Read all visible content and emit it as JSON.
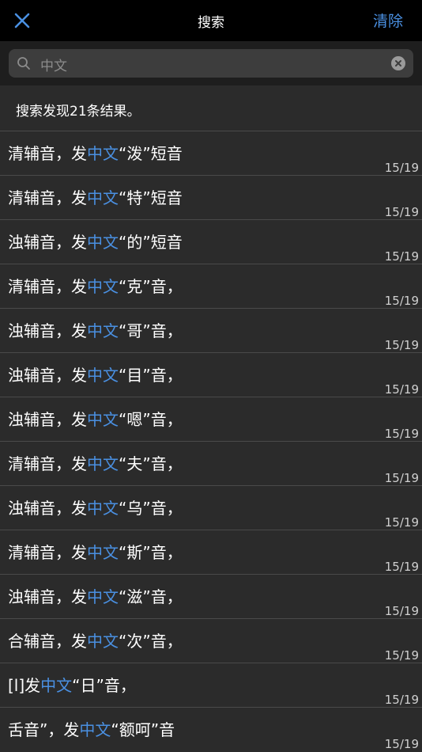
{
  "nav": {
    "title": "搜索",
    "clear_label": "清除",
    "close_icon": "close-icon"
  },
  "search": {
    "value": "中文",
    "placeholder": "中文"
  },
  "summary": "搜索发现21条结果。",
  "colors": {
    "accent": "#4a90e2",
    "background": "#2b2b2b",
    "nav_background": "#000000"
  },
  "results": [
    {
      "pre": "清辅音，发",
      "hl": "中文",
      "post": "“泼”短音",
      "page": "15/19"
    },
    {
      "pre": "清辅音，发",
      "hl": "中文",
      "post": "“特”短音",
      "page": "15/19"
    },
    {
      "pre": "浊辅音，发",
      "hl": "中文",
      "post": "“的”短音",
      "page": "15/19"
    },
    {
      "pre": "清辅音，发",
      "hl": "中文",
      "post": "“克”音，",
      "page": "15/19"
    },
    {
      "pre": "浊辅音，发",
      "hl": "中文",
      "post": "“哥”音，",
      "page": "15/19"
    },
    {
      "pre": "浊辅音，发",
      "hl": "中文",
      "post": "“目”音，",
      "page": "15/19"
    },
    {
      "pre": "浊辅音，发",
      "hl": "中文",
      "post": "“嗯”音，",
      "page": "15/19"
    },
    {
      "pre": "清辅音，发",
      "hl": "中文",
      "post": "“夫”音，",
      "page": "15/19"
    },
    {
      "pre": "浊辅音，发",
      "hl": "中文",
      "post": "“乌”音，",
      "page": "15/19"
    },
    {
      "pre": "清辅音，发",
      "hl": "中文",
      "post": "“斯”音，",
      "page": "15/19"
    },
    {
      "pre": "浊辅音，发",
      "hl": "中文",
      "post": "“滋”音，",
      "page": "15/19"
    },
    {
      "pre": "合辅音，发",
      "hl": "中文",
      "post": "“次”音，",
      "page": "15/19"
    },
    {
      "pre": " [l]发",
      "hl": "中文",
      "post": "“日”音，",
      "page": "15/19"
    },
    {
      "pre": "舌音”，发",
      "hl": "中文",
      "post": "“额呵”音",
      "page": "15/19"
    }
  ]
}
